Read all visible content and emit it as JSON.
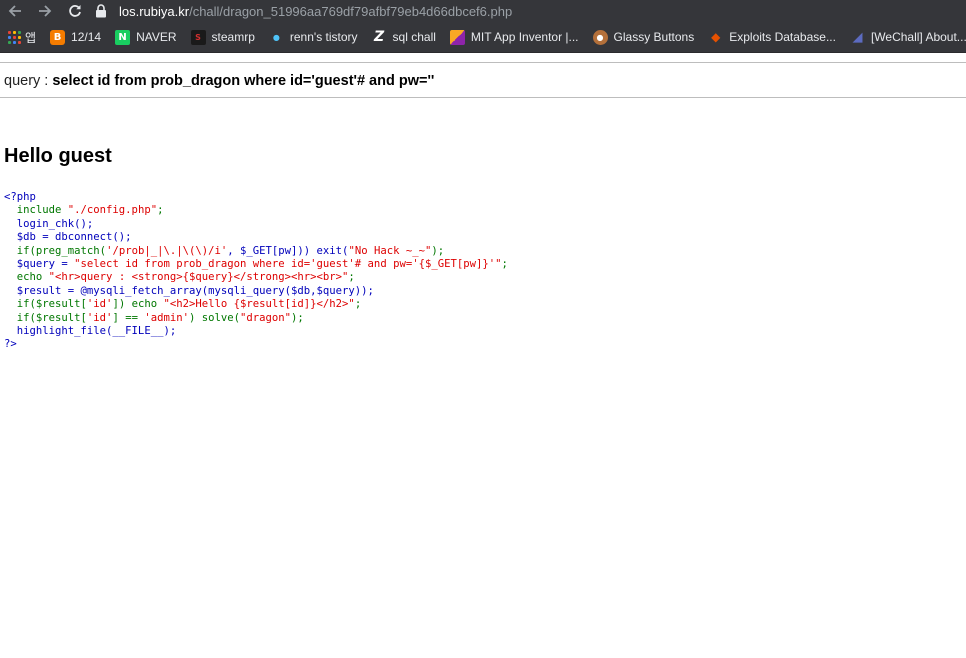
{
  "browser": {
    "back_icon": "arrow-left-icon",
    "forward_icon": "arrow-right-icon",
    "reload_icon": "reload-icon",
    "url_host": "los.rubiya.kr",
    "url_path": "/chall/dragon_51996aa769df79afbf79eb4d66dbcef6.php"
  },
  "bookmarks": [
    {
      "label": "앱"
    },
    {
      "label": "12/14"
    },
    {
      "label": "NAVER"
    },
    {
      "label": "steamrp"
    },
    {
      "label": "renn's tistory"
    },
    {
      "label": "sql chall"
    },
    {
      "label": "MIT App Inventor |..."
    },
    {
      "label": "Glassy Buttons"
    },
    {
      "label": "Exploits Database..."
    },
    {
      "label": "[WeChall] About..."
    }
  ],
  "page": {
    "query_label": "query : ",
    "query_value": "select id from prob_dragon where id='guest'# and pw=''",
    "hello": "Hello guest"
  },
  "source": {
    "line1": "<?php",
    "line2_a": "  include ",
    "line2_b": "\"./config.php\"",
    "line2_c": ";",
    "line3": "  login_chk();",
    "line4": "  $db = dbconnect();",
    "line5_a": "  if(preg_match(",
    "line5_b": "'/prob|_|\\.|\\(\\)/i'",
    "line5_c": ", $_GET[pw])) exit(",
    "line5_d": "\"No Hack ~_~\"",
    "line5_e": ");",
    "line6_a": "  $query = ",
    "line6_b": "\"select id from prob_dragon where id='guest'# and pw='{$_GET[pw]}'\"",
    "line6_c": ";",
    "line7_a": "  echo ",
    "line7_b": "\"<hr>query : <strong>{$query}</strong><hr><br>\"",
    "line7_c": ";",
    "line8": "  $result = @mysqli_fetch_array(mysqli_query($db,$query));",
    "line9_a": "  if($result[",
    "line9_b": "'id'",
    "line9_c": "]) echo ",
    "line9_d": "\"<h2>Hello {$result[id]}</h2>\"",
    "line9_e": ";",
    "line10_a": "  if($result[",
    "line10_b": "'id'",
    "line10_c": "] == ",
    "line10_d": "'admin'",
    "line10_e": ") solve(",
    "line10_f": "\"dragon\"",
    "line10_g": ");",
    "line11": "  highlight_file(__FILE__);",
    "line12": "?>"
  }
}
